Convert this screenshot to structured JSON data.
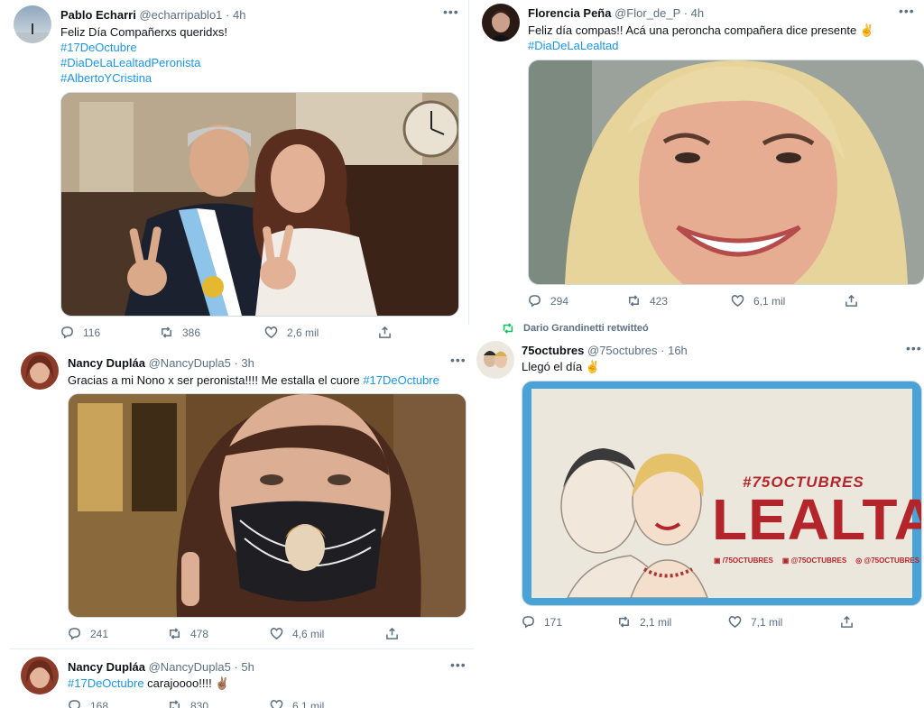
{
  "tweets": {
    "t1": {
      "name": "Pablo Echarri",
      "handle": "@echarripablo1",
      "time": "· 4h",
      "text": "Feliz Día Compañerxs queridxs!",
      "hashtags": [
        "#17DeOctubre",
        "#DiaDeLaLealtadPeronista",
        "#AlbertoYCristina"
      ],
      "replies": "116",
      "retweets": "386",
      "likes": "2,6 mil"
    },
    "t2": {
      "name": "Florencia Peña",
      "handle": "@Flor_de_P",
      "time": "· 4h",
      "text": "Feliz día compas!!  Acá una peroncha compañera dice presente ✌",
      "hashtags": [
        "#DiaDeLaLealtad"
      ],
      "replies": "294",
      "retweets": "423",
      "likes": "6,1 mil"
    },
    "t3": {
      "name": "Nancy Dupláa",
      "handle": "@NancyDupla5",
      "time": "· 3h",
      "text": "Gracias a mi Nono x ser peronista!!!! Me estalla el cuore ",
      "hashtag": "#17DeOctubre",
      "replies": "241",
      "retweets": "478",
      "likes": "4,6 mil"
    },
    "t4": {
      "retweet_by": "Dario Grandinetti retwitteó",
      "name": "75octubres",
      "handle": "@75octubres",
      "time": "· 16h",
      "text": "Llegó el día ✌",
      "poster": {
        "hashtag": "#75OCTUBRES",
        "headline": "LEALTAD",
        "social": [
          "/75OCTUBRES",
          "@75OCTUBRES",
          "@75OCTUBRES"
        ]
      },
      "replies": "171",
      "retweets": "2,1 mil",
      "likes": "7,1 mil"
    },
    "t5": {
      "name": "Nancy Dupláa",
      "handle": "@NancyDupla5",
      "time": "· 5h",
      "hashtag": "#17DeOctubre",
      "text": " carajoooo!!!! ✌🏽",
      "replies": "168",
      "retweets": "830",
      "likes": "6,1 mil"
    }
  },
  "icons": {
    "reply": "reply-icon",
    "retweet": "retweet-icon",
    "like": "heart-icon",
    "share": "share-icon",
    "more": "more-icon"
  },
  "colors": {
    "link": "#1b95e0",
    "muted": "#5b7083",
    "retweet_green": "#17bf63",
    "poster_red": "#b4252b",
    "poster_blue": "#4aa3d6"
  }
}
